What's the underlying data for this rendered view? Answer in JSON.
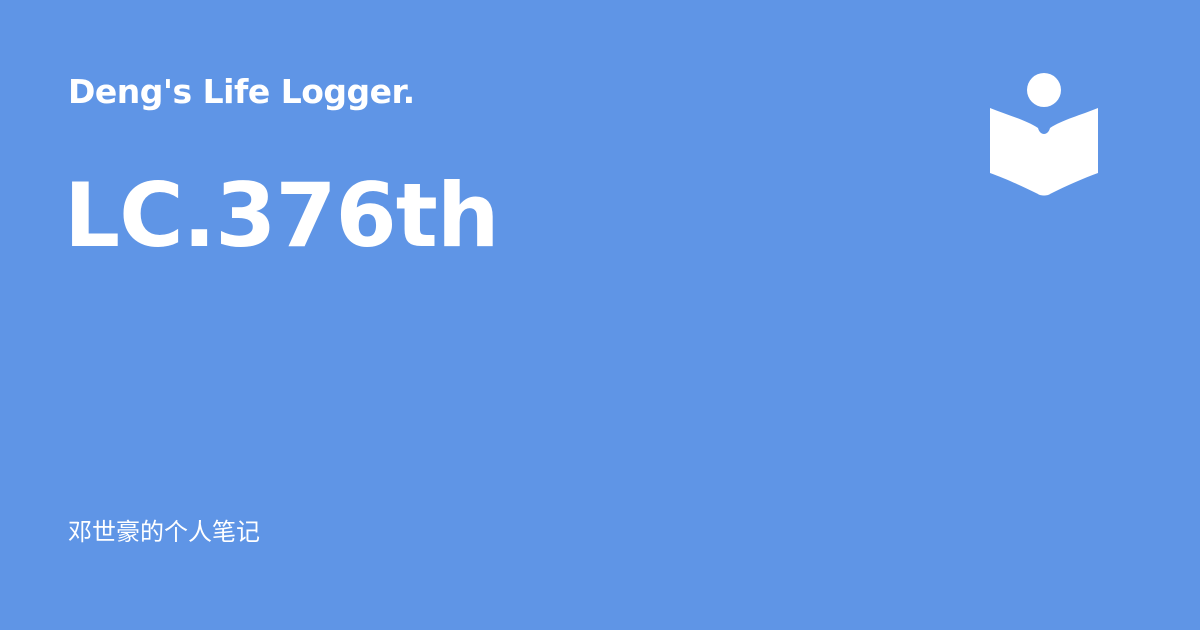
{
  "site": {
    "title": "Deng's Life Logger."
  },
  "post": {
    "title": "LC.376th"
  },
  "footer": {
    "text": "邓世豪的个人笔记"
  },
  "logo": {
    "icon": "reader-book-icon"
  },
  "colors": {
    "background": "#5f95e6",
    "foreground": "#ffffff"
  }
}
